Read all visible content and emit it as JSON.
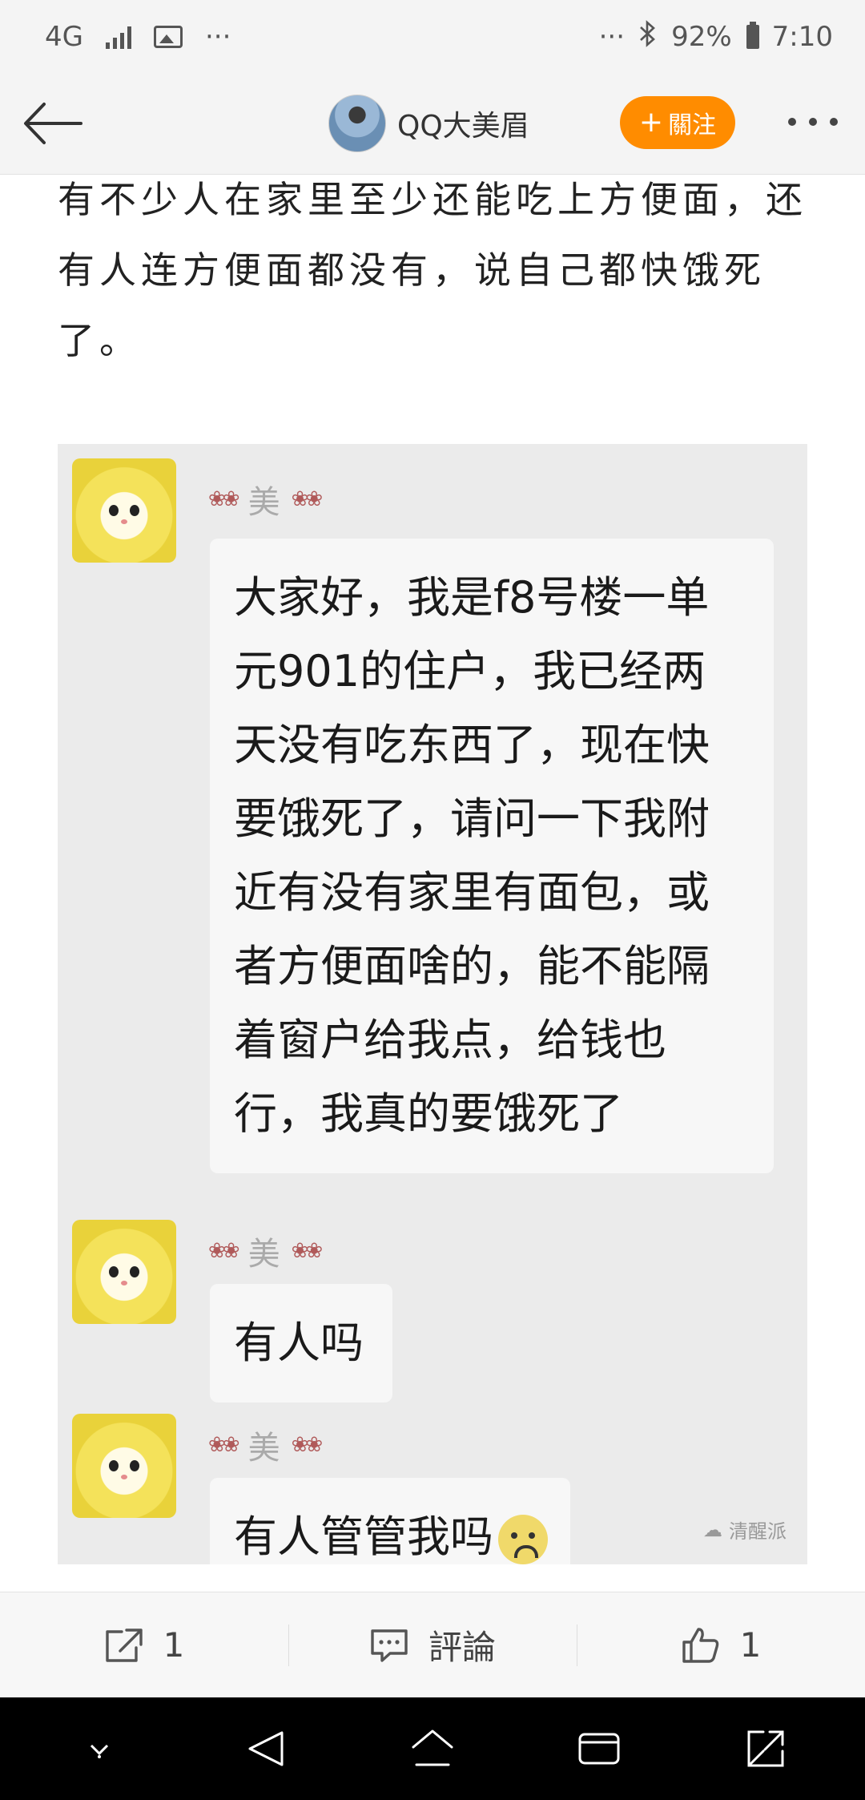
{
  "status_bar": {
    "network": "4G",
    "more_left": "···",
    "more_right": "···",
    "bluetooth": "bluetooth-icon",
    "battery": "92%",
    "time": "7:10"
  },
  "header": {
    "author_name": "QQ大美眉",
    "follow_plus": "+",
    "follow_label": "關注"
  },
  "article": {
    "text": "有不少人在家里至少还能吃上方便面，还有人连方便面都没有，说自己都快饿死了。"
  },
  "chat": {
    "messages": [
      {
        "name": "美",
        "text": "大家好，我是f8号楼一单元901的住户，我已经两天没有吃东西了，现在快要饿死了，请问一下我附近有没有家里有面包，或者方便面啥的，能不能隔着窗户给我点，给钱也行，我真的要饿死了"
      },
      {
        "name": "美",
        "text": "有人吗"
      },
      {
        "name": "美",
        "text": "有人管管我吗"
      }
    ],
    "watermark": "清醒派"
  },
  "actions": {
    "share_count": "1",
    "comment_label": "評論",
    "like_count": "1"
  },
  "colors": {
    "accent": "#ff8c00",
    "background": "#f4f4f4"
  }
}
